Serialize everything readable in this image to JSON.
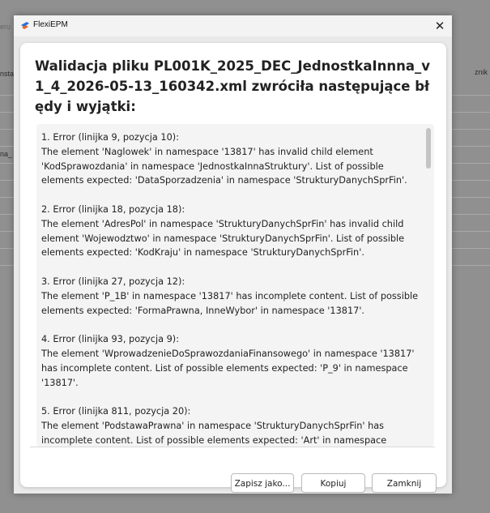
{
  "background": {
    "fragments": [
      "eru",
      "nsta",
      "na_",
      "znik"
    ]
  },
  "window": {
    "title": "FlexiEPM",
    "close_glyph": "✕"
  },
  "dialog": {
    "heading": "Walidacja pliku PL001K_2025_DEC_JednostkaInnna_v1_4_2026-05-13_160342.xml zwróciła następujące błędy i wyjątki:",
    "errors": [
      {
        "title": "1. Error (linijka 9, pozycja 10):",
        "message": "The element 'Naglowek' in namespace '13817' has invalid child element 'KodSprawozdania' in namespace 'JednostkaInnaStruktury'. List of possible elements expected: 'DataSporzadzenia' in namespace 'StrukturyDanychSprFin'."
      },
      {
        "title": "2. Error (linijka 18, pozycja 18):",
        "message": "The element 'AdresPol' in namespace 'StrukturyDanychSprFin' has invalid child element 'Wojewodztwo' in namespace 'StrukturyDanychSprFin'. List of possible elements expected: 'KodKraju' in namespace 'StrukturyDanychSprFin'."
      },
      {
        "title": "3. Error (linijka 27, pozycja 12):",
        "message": "The element 'P_1B' in namespace '13817' has incomplete content. List of possible elements expected: 'FormaPrawna, InneWybor' in namespace '13817'."
      },
      {
        "title": "4. Error (linijka 93, pozycja 9):",
        "message": "The element 'WprowadzenieDoSprawozdaniaFinansowego' in namespace '13817' has incomplete content. List of possible elements expected: 'P_9' in namespace '13817'."
      },
      {
        "title": "5. Error (linijka 811, pozycja 20):",
        "message": "The element 'PodstawaPrawna' in namespace 'StrukturyDanychSprFin' has incomplete content. List of possible elements expected: 'Art' in namespace"
      }
    ],
    "buttons": {
      "save_as": "Zapisz jako...",
      "copy": "Kopiuj",
      "close": "Zamknij"
    }
  }
}
